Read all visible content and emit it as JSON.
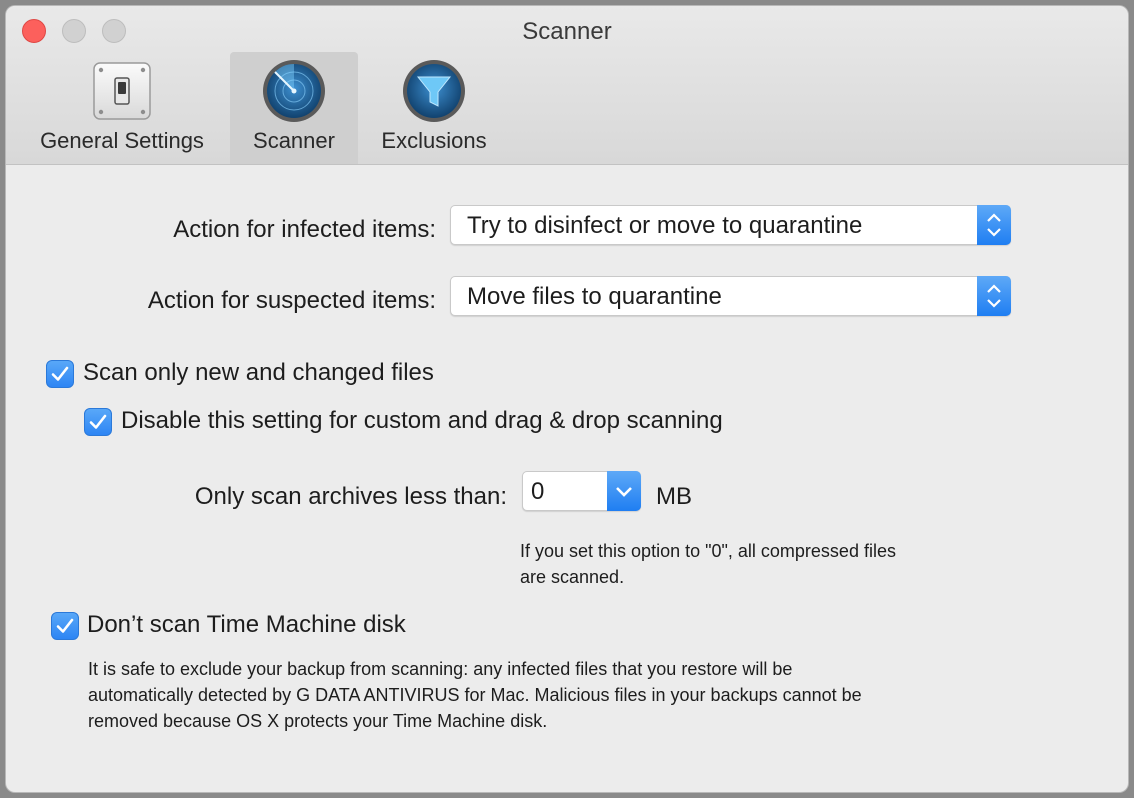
{
  "window": {
    "title": "Scanner"
  },
  "toolbar": {
    "tabs": [
      {
        "label": "General Settings",
        "icon": "switch-icon"
      },
      {
        "label": "Scanner",
        "icon": "radar-icon"
      },
      {
        "label": "Exclusions",
        "icon": "funnel-icon"
      }
    ],
    "active_tab": "Scanner"
  },
  "settings": {
    "infected": {
      "label": "Action for infected items:",
      "value": "Try to disinfect or move to quarantine"
    },
    "suspected": {
      "label": "Action for suspected items:",
      "value": "Move files to quarantine"
    },
    "scan_new": {
      "label": "Scan only new and changed files",
      "checked": true
    },
    "disable_custom": {
      "label": "Disable this setting for custom and drag & drop scanning",
      "checked": true
    },
    "archive": {
      "label": "Only scan archives less than:",
      "value": "0",
      "unit": "MB",
      "hint_line1": "If you set this option to \"0\", all compressed files",
      "hint_line2": "are scanned."
    },
    "time_machine": {
      "label": "Don’t scan Time Machine disk",
      "checked": true,
      "desc_line1": "It is safe to exclude your backup from scanning: any infected files that you restore will be",
      "desc_line2": "automatically detected by G DATA ANTIVIRUS for Mac. Malicious files in your backups cannot be",
      "desc_line3": "removed because OS X protects your Time Machine disk."
    }
  },
  "colors": {
    "accent": "#2d85f4",
    "close": "#fc605c",
    "window_bg": "#ececec"
  }
}
